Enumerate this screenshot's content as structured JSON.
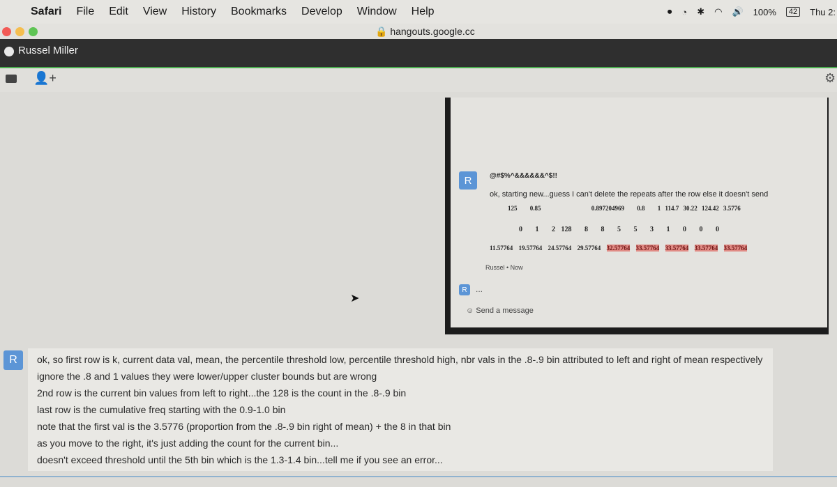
{
  "menubar": {
    "app": "Safari",
    "items": [
      "File",
      "Edit",
      "View",
      "History",
      "Bookmarks",
      "Develop",
      "Window",
      "Help"
    ],
    "battery": "100%",
    "battery_box": "42",
    "clock": "Thu 2:"
  },
  "browser": {
    "url": "hangouts.google.cc"
  },
  "hangout": {
    "contact": "Russel Miller"
  },
  "screenshot": {
    "avatar_letter": "R",
    "line1": "@#$%^&&&&&&^$!!",
    "line2": "ok, starting new...guess I can't delete the repeats after the row else it doesn't send",
    "row1": [
      "125",
      "0.85",
      "0.897204969",
      "0.8",
      "1",
      "114.7",
      "30.22",
      "124.42",
      "3.5776"
    ],
    "row2": [
      "0",
      "1",
      "2",
      "128",
      "8",
      "8",
      "5",
      "5",
      "3",
      "1",
      "0",
      "0",
      "0"
    ],
    "row3": [
      "11.57764",
      "19.57764",
      "24.57764",
      "29.57764",
      "32.57764",
      "33.57764",
      "33.57764",
      "33.57764",
      "33.57764"
    ],
    "meta": "Russel • Now",
    "typing": "...",
    "send_placeholder": "Send a message"
  },
  "message": {
    "avatar_letter": "R",
    "lines": [
      "ok, so first row is k, current data val, mean, the percentile threshold low, percentile threshold high, nbr vals in the .8-.9 bin attributed to left and right of mean respectively",
      "ignore the .8 and 1 values they were lower/upper cluster bounds but are wrong",
      "2nd row is the current bin values from left to right...the 128 is the count in the .8-.9 bin",
      "last row is the cumulative freq starting with the 0.9-1.0 bin",
      "note that the first val is the 3.5776 (proportion from the .8-.9 bin right of mean) + the 8 in that bin",
      "as you move to the right, it's just adding the count for the current bin...",
      "doesn't exceed threshold until the 5th bin which is the 1.3-1.4 bin...tell me if you see an error..."
    ]
  }
}
